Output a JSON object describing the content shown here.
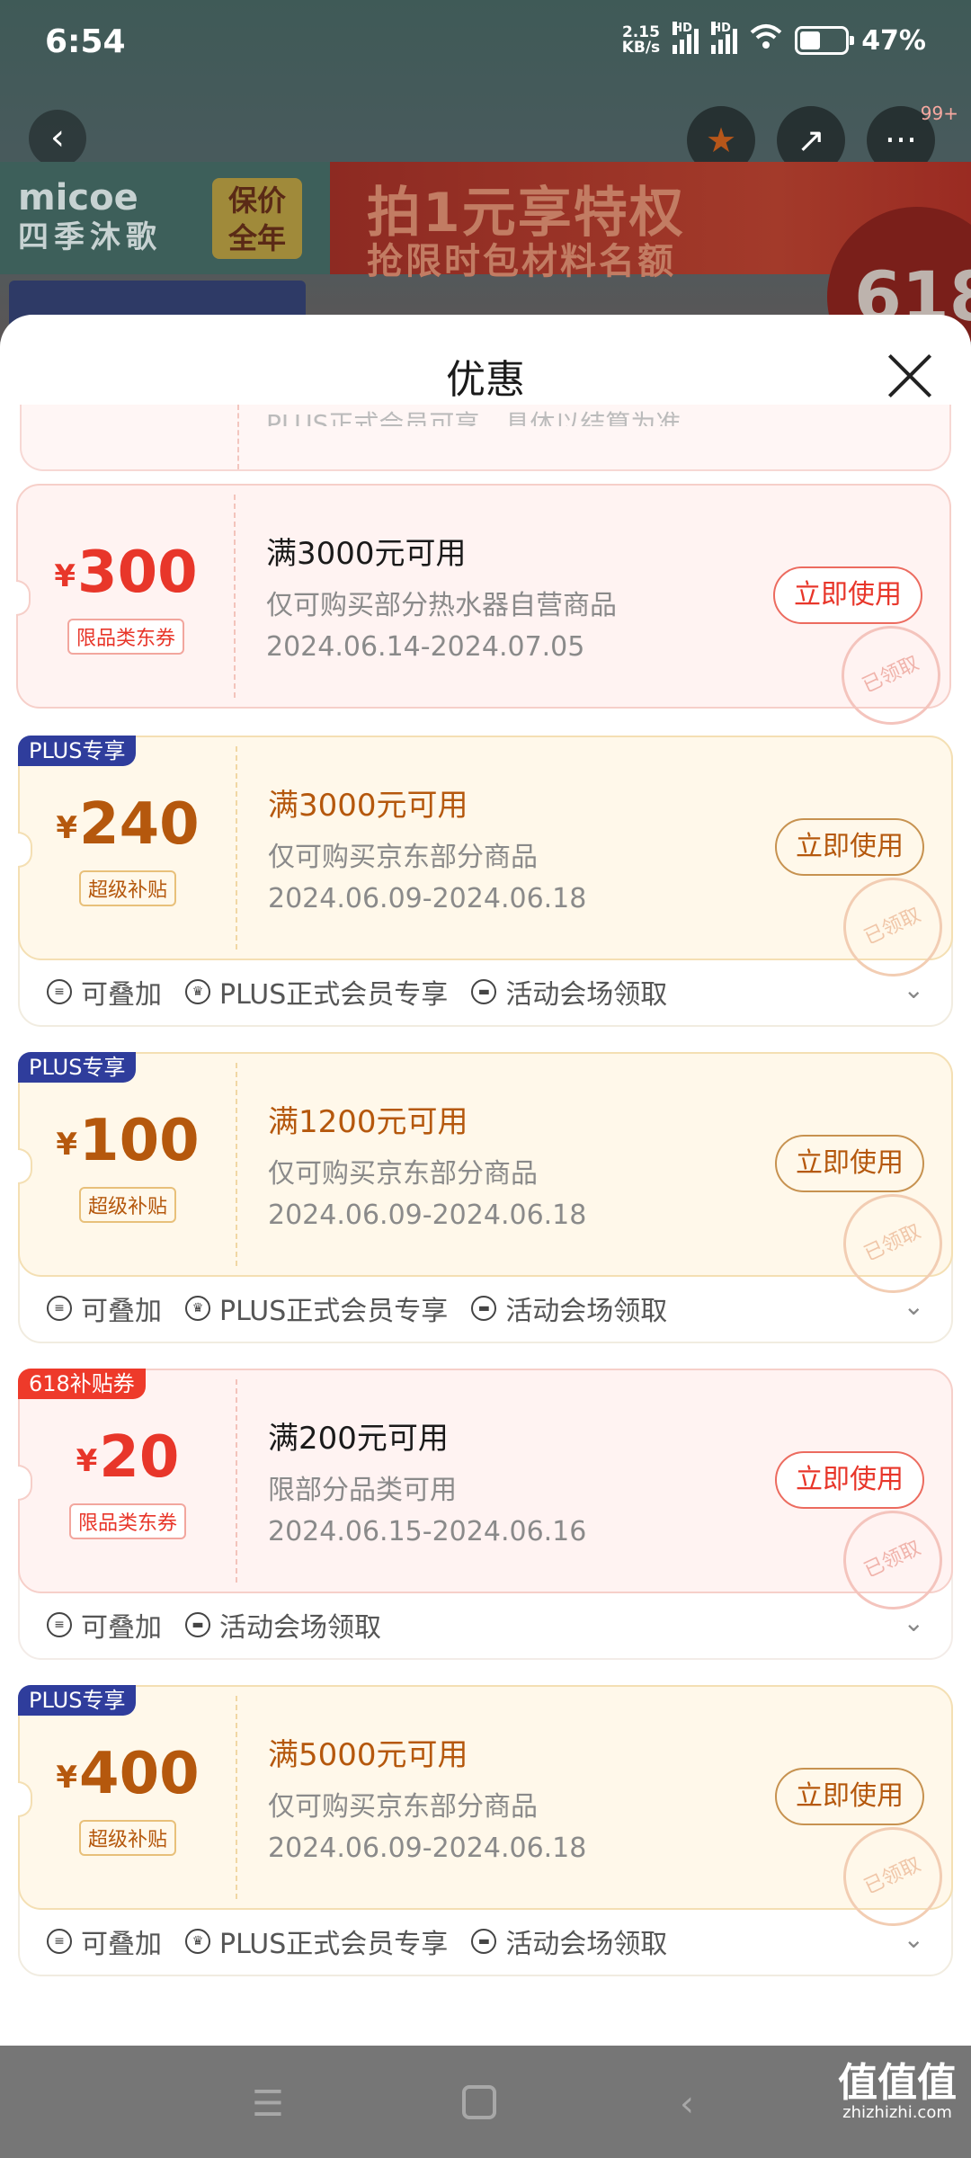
{
  "status_bar": {
    "time": "6:54",
    "net_speed_value": "2.15",
    "net_speed_unit": "KB/s",
    "sig1_label": "HD",
    "sig2_label": "HD",
    "battery_text": "47%",
    "battery_level": 0.47
  },
  "background_page": {
    "back_icon": "chevron-left-icon",
    "notification_count": "99+",
    "banner_brand": "micoe",
    "banner_brand_cn": "四季沐歌",
    "banner_tag_line1": "保价",
    "banner_tag_line2": "全年",
    "banner_title": "拍1元享特权",
    "banner_subtitle": "抢限时包材料名额",
    "banner_badge": "618"
  },
  "sheet": {
    "title": "优惠",
    "partial_text": "PLUS正式会员可享，具体以结算为准"
  },
  "coupons": [
    {
      "tag": "",
      "symbol": "¥",
      "amount": "300",
      "type_label": "限品类东券",
      "condition": "满3000元可用",
      "scope": "仅可购买部分热水器自营商品",
      "date": "2024.06.14-2024.07.05",
      "button": "立即使用",
      "stamp": "已领取",
      "theme": "red"
    },
    {
      "tag": "PLUS专享",
      "symbol": "¥",
      "amount": "240",
      "type_label": "超级补贴",
      "condition": "满3000元可用",
      "scope": "仅可购买京东部分商品",
      "date": "2024.06.09-2024.06.18",
      "button": "立即使用",
      "stamp": "已领取",
      "theme": "gold",
      "benefits": [
        "可叠加",
        "PLUS正式会员专享",
        "活动会场领取"
      ]
    },
    {
      "tag": "PLUS专享",
      "symbol": "¥",
      "amount": "100",
      "type_label": "超级补贴",
      "condition": "满1200元可用",
      "scope": "仅可购买京东部分商品",
      "date": "2024.06.09-2024.06.18",
      "button": "立即使用",
      "stamp": "已领取",
      "theme": "gold",
      "benefits": [
        "可叠加",
        "PLUS正式会员专享",
        "活动会场领取"
      ]
    },
    {
      "tag": "618补贴券",
      "symbol": "¥",
      "amount": "20",
      "type_label": "限品类东券",
      "condition": "满200元可用",
      "scope": "限部分品类可用",
      "date": "2024.06.15-2024.06.16",
      "button": "立即使用",
      "stamp": "已领取",
      "theme": "red",
      "benefits": [
        "可叠加",
        "活动会场领取"
      ]
    },
    {
      "tag": "PLUS专享",
      "symbol": "¥",
      "amount": "400",
      "type_label": "超级补贴",
      "condition": "满5000元可用",
      "scope": "仅可购买京东部分商品",
      "date": "2024.06.09-2024.06.18",
      "button": "立即使用",
      "stamp": "已领取",
      "theme": "gold",
      "benefits": [
        "可叠加",
        "PLUS正式会员专享",
        "活动会场领取"
      ]
    }
  ],
  "navbar": {
    "watermark": "值值值",
    "watermark_url": "zhizhizhi.com"
  },
  "colors": {
    "red_accent": "#e8362a",
    "gold_accent": "#b5580d",
    "plus_tag": "#2f3d9c",
    "tag_618": "#ee3a2a"
  }
}
